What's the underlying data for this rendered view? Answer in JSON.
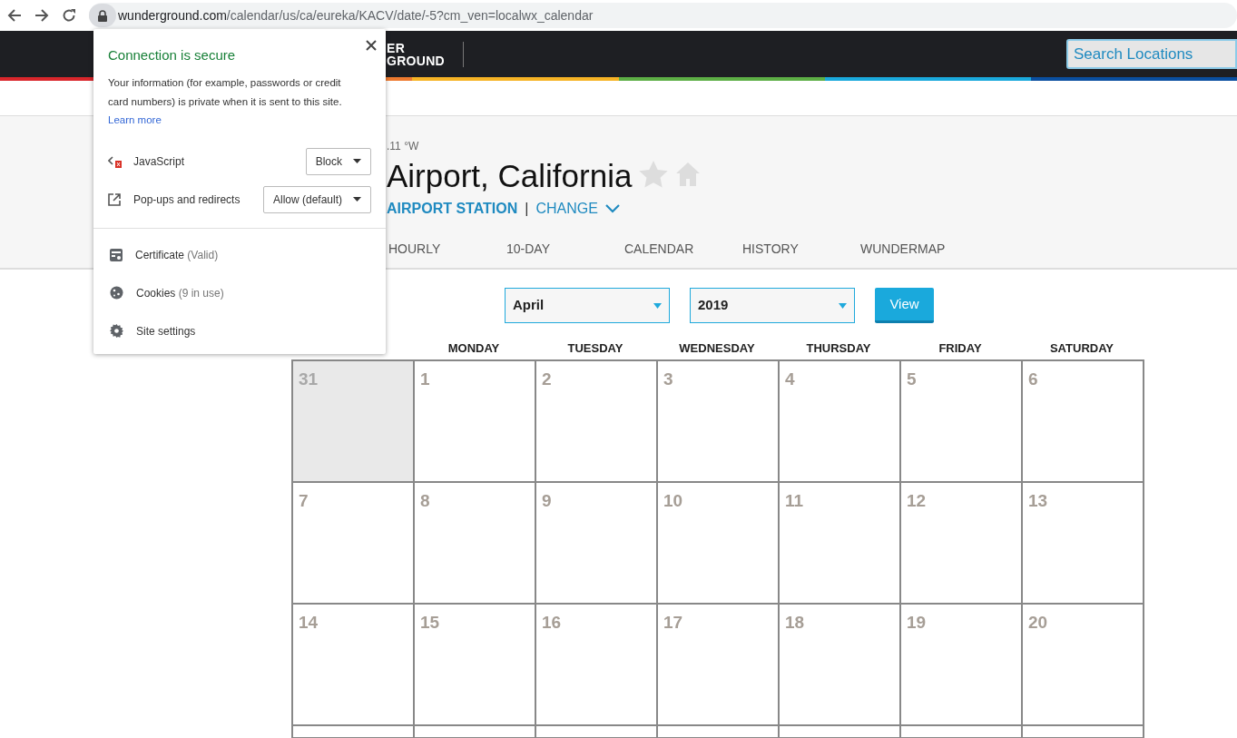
{
  "browser": {
    "url_host": "wunderground.com",
    "url_path": "/calendar/us/ca/eureka/KACV/date/-5?cm_ven=localwx_calendar"
  },
  "header": {
    "logo_lines": [
      "ER",
      "GROUND"
    ],
    "search": {
      "placeholder": "Search Locations"
    }
  },
  "location": {
    "coords": ".11 °W",
    "title": "Airport, California",
    "station": "AIRPORT STATION",
    "separator": "|",
    "change": "CHANGE"
  },
  "tabs": [
    "HOURLY",
    "10-DAY",
    "CALENDAR",
    "HISTORY",
    "WUNDERMAP"
  ],
  "calendar": {
    "month": "April",
    "year": "2019",
    "view_button": "View",
    "weekdays": [
      "MONDAY",
      "TUESDAY",
      "WEDNESDAY",
      "THURSDAY",
      "FRIDAY",
      "SATURDAY"
    ],
    "weeks": [
      [
        {
          "day": "31",
          "other_month": true
        },
        {
          "day": "1",
          "other_month": false
        },
        {
          "day": "2",
          "other_month": false
        },
        {
          "day": "3",
          "other_month": false
        },
        {
          "day": "4",
          "other_month": false
        },
        {
          "day": "5",
          "other_month": false
        },
        {
          "day": "6",
          "other_month": false
        }
      ],
      [
        {
          "day": "7",
          "other_month": false
        },
        {
          "day": "8",
          "other_month": false
        },
        {
          "day": "9",
          "other_month": false
        },
        {
          "day": "10",
          "other_month": false
        },
        {
          "day": "11",
          "other_month": false
        },
        {
          "day": "12",
          "other_month": false
        },
        {
          "day": "13",
          "other_month": false
        }
      ],
      [
        {
          "day": "14",
          "other_month": false
        },
        {
          "day": "15",
          "other_month": false
        },
        {
          "day": "16",
          "other_month": false
        },
        {
          "day": "17",
          "other_month": false
        },
        {
          "day": "18",
          "other_month": false
        },
        {
          "day": "19",
          "other_month": false
        },
        {
          "day": "20",
          "other_month": false
        }
      ]
    ]
  },
  "popup": {
    "title": "Connection is secure",
    "text": "Your information (for example, passwords or credit card numbers) is private when it is sent to this site.",
    "link": "Learn more",
    "permissions": [
      {
        "kind": "javascript",
        "label": "JavaScript",
        "value": "Block"
      },
      {
        "kind": "popups",
        "label": "Pop-ups and redirects",
        "value": "Allow (default)"
      }
    ],
    "items": [
      {
        "kind": "certificate",
        "label": "Certificate",
        "note": "(Valid)"
      },
      {
        "kind": "cookies",
        "label": "Cookies",
        "note": "(9 in use)"
      },
      {
        "kind": "settings",
        "label": "Site settings"
      }
    ]
  }
}
